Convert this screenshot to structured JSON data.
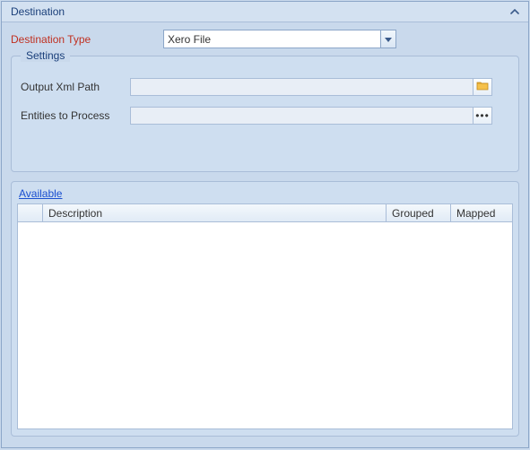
{
  "panel": {
    "title": "Destination"
  },
  "destination": {
    "type_label": "Destination Type",
    "type_value": "Xero File"
  },
  "settings": {
    "title": "Settings",
    "output_path_label": "Output Xml Path",
    "output_path_value": "",
    "entities_label": "Entities to Process",
    "entities_value": ""
  },
  "grid": {
    "link_label": "Available ",
    "columns": {
      "description": "Description",
      "grouped": "Grouped",
      "mapped": "Mapped"
    }
  }
}
